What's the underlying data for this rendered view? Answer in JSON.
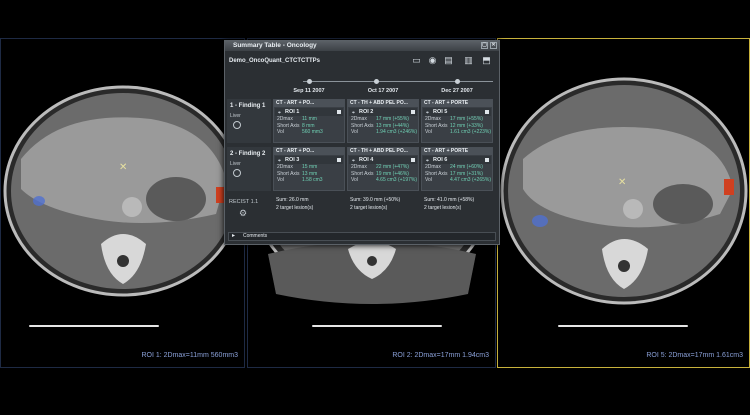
{
  "viewports": [
    {
      "label": "ROI 1: 2Dmax=11mm 560mm3",
      "lesion_color": "#5070d0"
    },
    {
      "label": "ROI 2: 2Dmax=17mm 1.94cm3",
      "lesion_color": "#5070d0"
    },
    {
      "label": "ROI 5: 2Dmax=17mm 1.61cm3",
      "lesion_color": "#5070d0"
    }
  ],
  "panel": {
    "title": "Summary Table - Oncology",
    "case_name": "Demo_OncoQuant_CTCTCTTPs",
    "toolbar_icons": [
      "folder-icon",
      "camera-icon",
      "export-icon",
      "report-icon",
      "share-icon"
    ],
    "dates": [
      "Sep 11 2007",
      "Oct 17 2007",
      "Dec 27 2007"
    ],
    "findings": [
      {
        "title": "1 - Finding 1",
        "sub": "Liver",
        "cells": [
          {
            "series": "CT - ART + PO...",
            "roi": "ROI 1",
            "rows": [
              [
                "2Dmax",
                "11 mm"
              ],
              [
                "Short Axis",
                "8 mm"
              ],
              [
                "Vol",
                "560 mm3"
              ]
            ]
          },
          {
            "series": "CT - TH + ABD PEL PO...",
            "roi": "ROI 2",
            "rows": [
              [
                "2Dmax",
                "17 mm (+55%)"
              ],
              [
                "Short Axis",
                "13 mm (+44%)"
              ],
              [
                "Vol",
                "1.94 cm3 (+246%)"
              ]
            ]
          },
          {
            "series": "CT - ART + PORTE",
            "roi": "ROI 5",
            "rows": [
              [
                "2Dmax",
                "17 mm (+55%)"
              ],
              [
                "Short Axis",
                "12 mm (+33%)"
              ],
              [
                "Vol",
                "1.61 cm3 (+223%)"
              ]
            ]
          }
        ]
      },
      {
        "title": "2 - Finding 2",
        "sub": "Liver",
        "cells": [
          {
            "series": "CT - ART + PO...",
            "roi": "ROI 3",
            "rows": [
              [
                "2Dmax",
                "15 mm"
              ],
              [
                "Short Axis",
                "13 mm"
              ],
              [
                "Vol",
                "1.58 cm3"
              ]
            ]
          },
          {
            "series": "CT - TH + ABD PEL PO...",
            "roi": "ROI 4",
            "rows": [
              [
                "2Dmax",
                "22 mm (+47%)"
              ],
              [
                "Short Axis",
                "19 mm (+46%)"
              ],
              [
                "Vol",
                "4.65 cm3 (+197%)"
              ]
            ]
          },
          {
            "series": "CT - ART + PORTE",
            "roi": "ROI 6",
            "rows": [
              [
                "2Dmax",
                "24 mm (+60%)"
              ],
              [
                "Short Axis",
                "17 mm (+31%)"
              ],
              [
                "Vol",
                "4.47 cm3 (+265%)"
              ]
            ]
          }
        ]
      }
    ],
    "recist_label": "RECIST 1.1",
    "summary": [
      {
        "sum": "Sum: 26.0 mm",
        "lesions": "2 target lesion(s)"
      },
      {
        "sum": "Sum: 39.0 mm (+50%)",
        "lesions": "2 target lesion(s)"
      },
      {
        "sum": "Sum: 41.0 mm (+58%)",
        "lesions": "2 target lesion(s)"
      }
    ],
    "comments_label": "Comments"
  }
}
